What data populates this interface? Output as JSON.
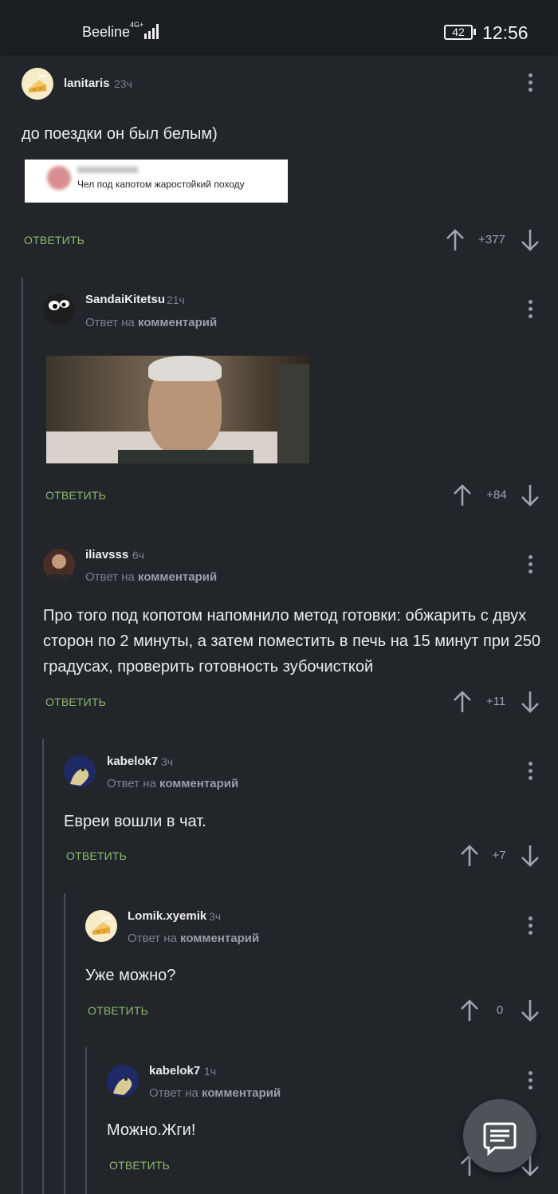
{
  "status_bar": {
    "carrier": "Beeline",
    "network": "4G+",
    "battery": "42",
    "time": "12:56"
  },
  "ui": {
    "reply_prefix": "Ответ на",
    "reply_target": "комментарий",
    "reply_button": "ОТВЕТИТЬ"
  },
  "comments": [
    {
      "user": "lanitaris",
      "time": "23ч",
      "text": "до поездки он был белым)",
      "embed_text": "Чел под капотом жаростойкий походу",
      "score": "+377"
    },
    {
      "user": "SandaiKitetsu",
      "time": "21ч",
      "score": "+84"
    },
    {
      "user": "iliavsss",
      "time": "6ч",
      "text": "Про того под копотом напомнило метод готовки: обжарить с двух сторон по 2 минуты, а затем поместить в печь на 15 минут при 250 градусах, проверить готовность зубочисткой",
      "score": "+11"
    },
    {
      "user": "kabelok7",
      "time": "3ч",
      "text": "Евреи вошли в чат.",
      "score": "+7"
    },
    {
      "user": "Lomik.xyemik",
      "time": "3ч",
      "text": "Уже можно?",
      "score": "0"
    },
    {
      "user": "kabelok7",
      "time": "1ч",
      "text": "Можно.Жги!"
    }
  ],
  "icons": {
    "more": "more-vertical-icon",
    "upvote": "arrow-up-icon",
    "downvote": "arrow-down-icon",
    "fab": "comment-icon"
  },
  "colors": {
    "background": "#22262b",
    "reply_green": "#8cb870",
    "muted": "#7c8187"
  }
}
